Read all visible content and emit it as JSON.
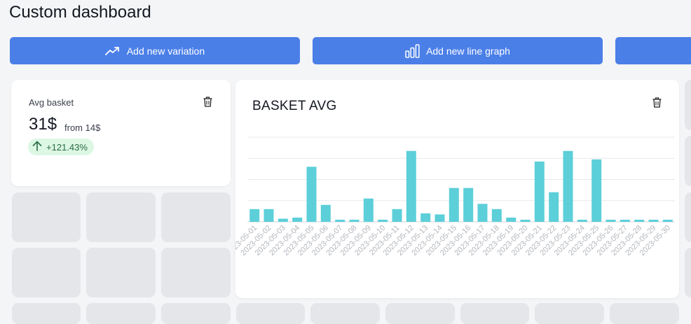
{
  "page": {
    "title": "Custom dashboard"
  },
  "toolbar": {
    "buttons": [
      {
        "label": "Add new variation",
        "icon": "trending-up-icon"
      },
      {
        "label": "Add new line graph",
        "icon": "bar-chart-icon"
      }
    ]
  },
  "kpi_card": {
    "label": "Avg basket",
    "value": "31$",
    "from": "from 14$",
    "change": "+121.43%",
    "change_icon": "arrow-up-icon",
    "badge_color": "#dcf7e4"
  },
  "chart_card": {
    "title": "BASKET AVG"
  },
  "colors": {
    "accent": "#4b7fe8",
    "bar": "#5ccfd9",
    "placeholder": "#e5e6ea"
  },
  "chart_data": {
    "type": "bar",
    "title": "BASKET AVG",
    "xlabel": "",
    "ylabel": "",
    "grid": true,
    "ylim": [
      0,
      40
    ],
    "categories": [
      "2023-05-01",
      "2023-05-02",
      "2023-05-03",
      "2023-05-04",
      "2023-05-05",
      "2023-05-06",
      "2023-05-07",
      "2023-05-08",
      "2023-05-09",
      "2023-05-10",
      "2023-05-11",
      "2023-05-12",
      "2023-05-13",
      "2023-05-14",
      "2023-05-15",
      "2023-05-16",
      "2023-05-17",
      "2023-05-18",
      "2023-05-19",
      "2023-05-20",
      "2023-05-21",
      "2023-05-22",
      "2023-05-23",
      "2023-05-24",
      "2023-05-25",
      "2023-05-26",
      "2023-05-27",
      "2023-05-28",
      "2023-05-29",
      "2023-05-30"
    ],
    "values": [
      6,
      6,
      1.5,
      2,
      26,
      8,
      1,
      1,
      11,
      1,
      6,
      33.5,
      4,
      3.5,
      16,
      16,
      8.5,
      6,
      2,
      1,
      28.5,
      14,
      33.5,
      1,
      29.5,
      1,
      1,
      1,
      1,
      1
    ]
  }
}
